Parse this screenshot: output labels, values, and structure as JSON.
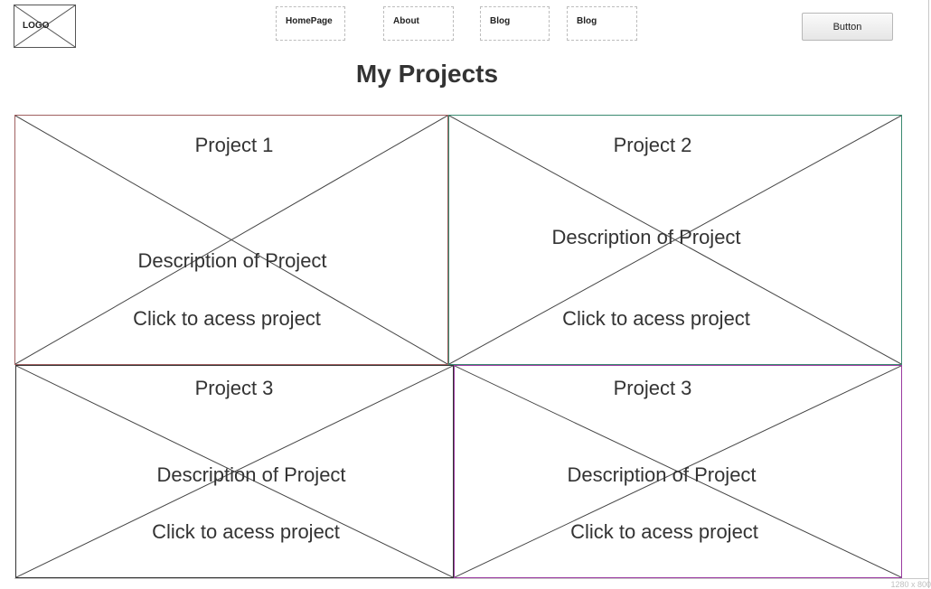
{
  "header": {
    "logo_label": "LOGO",
    "nav": [
      "HomePage",
      "About",
      "Blog",
      "Blog"
    ],
    "button_label": "Button"
  },
  "page_title": "My Projects",
  "projects": [
    {
      "title": "Project 1",
      "description": "Description of Project",
      "link": "Click to acess project",
      "border_color": "#a06060"
    },
    {
      "title": "Project 2",
      "description": "Description of Project",
      "link": "Click to acess project",
      "border_color": "#3a8a70"
    },
    {
      "title": "Project 3",
      "description": "Description of Project",
      "link": "Click to acess project",
      "border_color": "#333333"
    },
    {
      "title": "Project 3",
      "description": "Description of Project",
      "link": "Click to acess project",
      "border_color": "#9a3aa0"
    }
  ],
  "canvas_size_label": "1280 x 800"
}
